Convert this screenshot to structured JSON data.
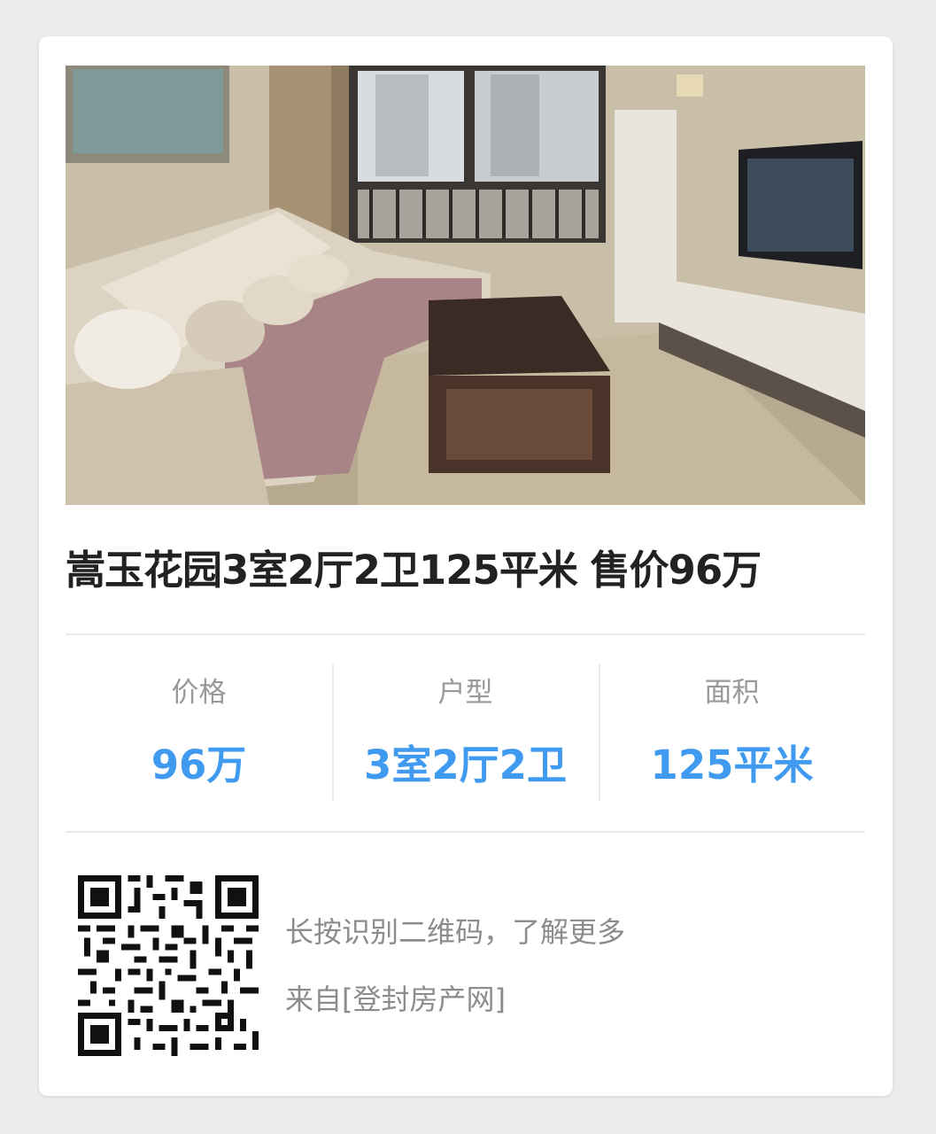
{
  "listing": {
    "title": "嵩玉花园3室2厅2卫125平米 售价96万"
  },
  "stats": [
    {
      "label": "价格",
      "value": "96万"
    },
    {
      "label": "户型",
      "value": "3室2厅2卫"
    },
    {
      "label": "面积",
      "value": "125平米"
    }
  ],
  "footer": {
    "qr_hint": "长按识别二维码，了解更多",
    "source": "来自[登封房产网]"
  },
  "icons": {
    "photo": "living-room-photo",
    "qr": "qr-code-icon"
  },
  "colors": {
    "accent": "#3f9af0",
    "title": "#222222",
    "label": "#999999"
  }
}
